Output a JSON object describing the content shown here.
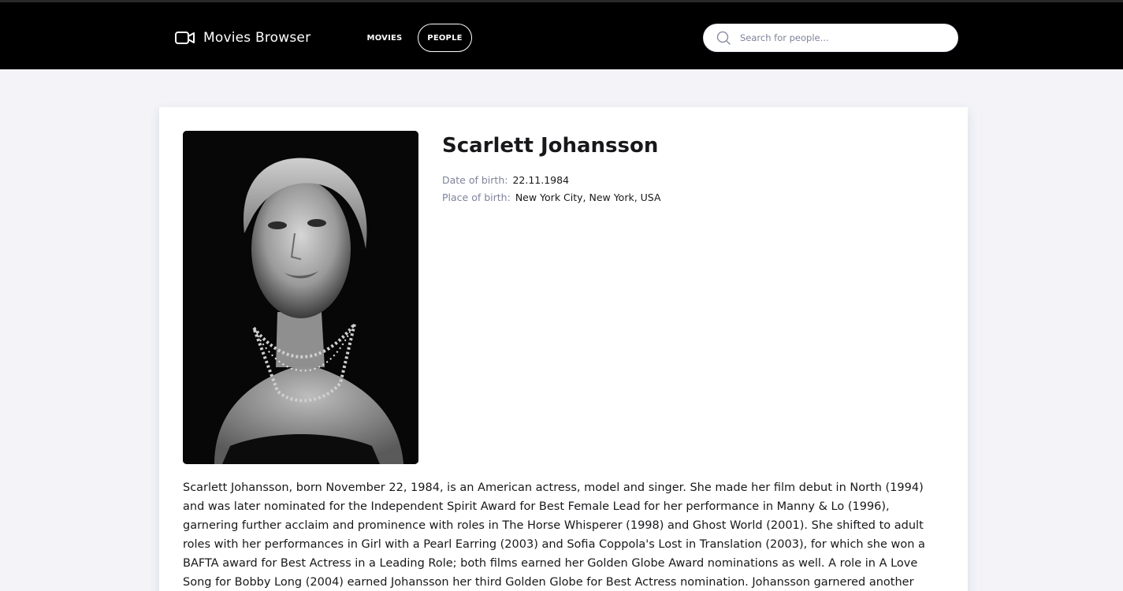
{
  "header": {
    "brand_title": "Movies Browser",
    "nav": [
      {
        "label": "MOVIES",
        "active": false
      },
      {
        "label": "PEOPLE",
        "active": true
      }
    ],
    "search_placeholder": "Search for people...",
    "search_value": ""
  },
  "person": {
    "name": "Scarlett Johansson",
    "birth_date_label": "Date of birth:",
    "birth_date": "22.11.1984",
    "birth_place_label": "Place of birth:",
    "birth_place": "New York City, New York, USA",
    "bio": "Scarlett Johansson, born November 22, 1984, is an American actress, model and singer. She made her film debut in North (1994) and was later nominated for the Independent Spirit Award for Best Female Lead for her performance in Manny & Lo (1996), garnering further acclaim and prominence with roles in The Horse Whisperer (1998) and Ghost World (2001). She shifted to adult roles with her performances in Girl with a Pearl Earring (2003) and Sofia Coppola's Lost in Translation (2003), for which she won a BAFTA award for Best Actress in a Leading Role; both films earned her Golden Globe Award nominations as well. A role in A Love Song for Bobby Long (2004) earned Johansson her third Golden Globe for Best Actress nomination. Johansson garnered another"
  },
  "colors": {
    "header_bg": "#000000",
    "page_bg": "#f4f4f8",
    "label_gray": "#7e839a"
  }
}
